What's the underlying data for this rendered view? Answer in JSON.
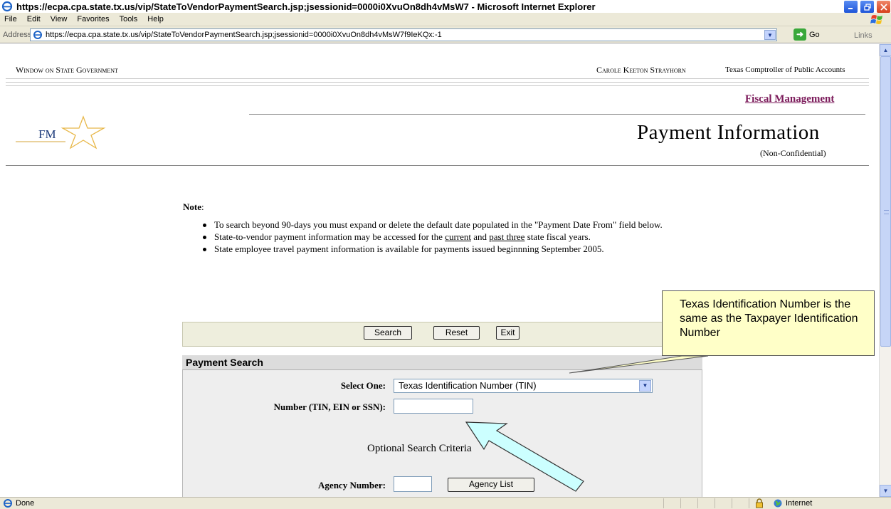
{
  "browser": {
    "window_title": "https://ecpa.cpa.state.tx.us/vip/StateToVendorPaymentSearch.jsp;jsessionid=0000i0XvuOn8dh4vMsW7 - Microsoft Internet Explorer",
    "menu": [
      "File",
      "Edit",
      "View",
      "Favorites",
      "Tools",
      "Help"
    ],
    "address_label": "Address",
    "url": "https://ecpa.cpa.state.tx.us/vip/StateToVendorPaymentSearch.jsp;jsessionid=0000i0XvuOn8dh4vMsW7f9IeKQx:-1",
    "go_label": "Go",
    "links_label": "Links",
    "status_text": "Done",
    "zone_text": "Internet"
  },
  "header": {
    "left_title": "Window on State Government",
    "comptroller_name": "Carole Keeton Strayhorn",
    "agency_name": "Texas Comptroller of Public Accounts",
    "section_link": "Fiscal Management",
    "logo_text": "FM",
    "page_title": "Payment Information",
    "page_subtitle": "(Non-Confidential)"
  },
  "note": {
    "label": "Note",
    "items": {
      "item1": "To search beyond 90-days you must expand or delete the default date populated in the \"Payment Date From\" field below.",
      "item2_pre": "State-to-vendor payment information may be accessed for the ",
      "item2_current": "current",
      "item2_mid": " and ",
      "item2_past": "past three",
      "item2_post": " state fiscal years.",
      "item3": "State employee travel payment information is available for payments issued beginnning September 2005."
    }
  },
  "buttons": {
    "search": "Search",
    "reset": "Reset",
    "exit": "Exit"
  },
  "payment_search": {
    "heading": "Payment Search",
    "select_label": "Select One:",
    "select_value": "Texas Identification Number (TIN)",
    "number_label": "Number (TIN, EIN or SSN):",
    "number_value": "",
    "optional_heading": "Optional Search Criteria",
    "agency_label": "Agency Number:",
    "agency_value": "",
    "agency_list_button": "Agency List"
  },
  "callout": {
    "text": "Texas Identification Number is the same as the Taxpayer Identification Number"
  },
  "colors": {
    "link_purple": "#7b1a5a",
    "callout_fill": "#ffffc8",
    "arrow_fill": "#ccffff",
    "button_bar": "#eeeedd"
  }
}
